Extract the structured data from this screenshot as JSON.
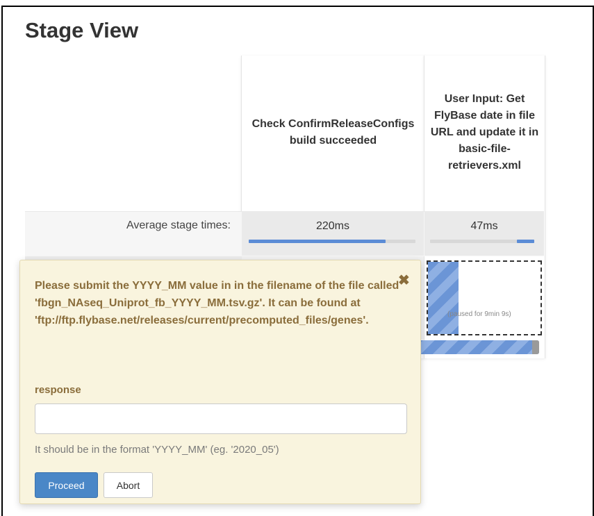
{
  "page": {
    "title": "Stage View"
  },
  "stages": [
    {
      "header": "Check ConfirmReleaseConfigs build succeeded",
      "avg_time": "220ms",
      "avg_progress": 0.82
    },
    {
      "header": "User Input: Get FlyBase date in file URL and update it in basic-file-retrievers.xml",
      "avg_time": "47ms",
      "avg_progress": 0.17
    }
  ],
  "avg_row_label": "Average stage times:",
  "paused_cell": {
    "status_text": "(paused for 9min 9s)"
  },
  "input_dialog": {
    "close_icon": "close-icon",
    "message": "Please submit the YYYY_MM value in in the filename of the file called 'fbgn_NAseq_Uniprot_fb_YYYY_MM.tsv.gz'. It can be found at 'ftp://ftp.flybase.net/releases/current/precomputed_files/genes'.",
    "response_label": "response",
    "response_value": "",
    "hint": "It should be in the format 'YYYY_MM' (eg. '2020_05')",
    "proceed_label": "Proceed",
    "abort_label": "Abort"
  },
  "colors": {
    "progress": "#5b8cd6",
    "primary_button": "#4a87c7",
    "dialog_bg": "#f9f4de",
    "dialog_text": "#8a6d3b"
  }
}
